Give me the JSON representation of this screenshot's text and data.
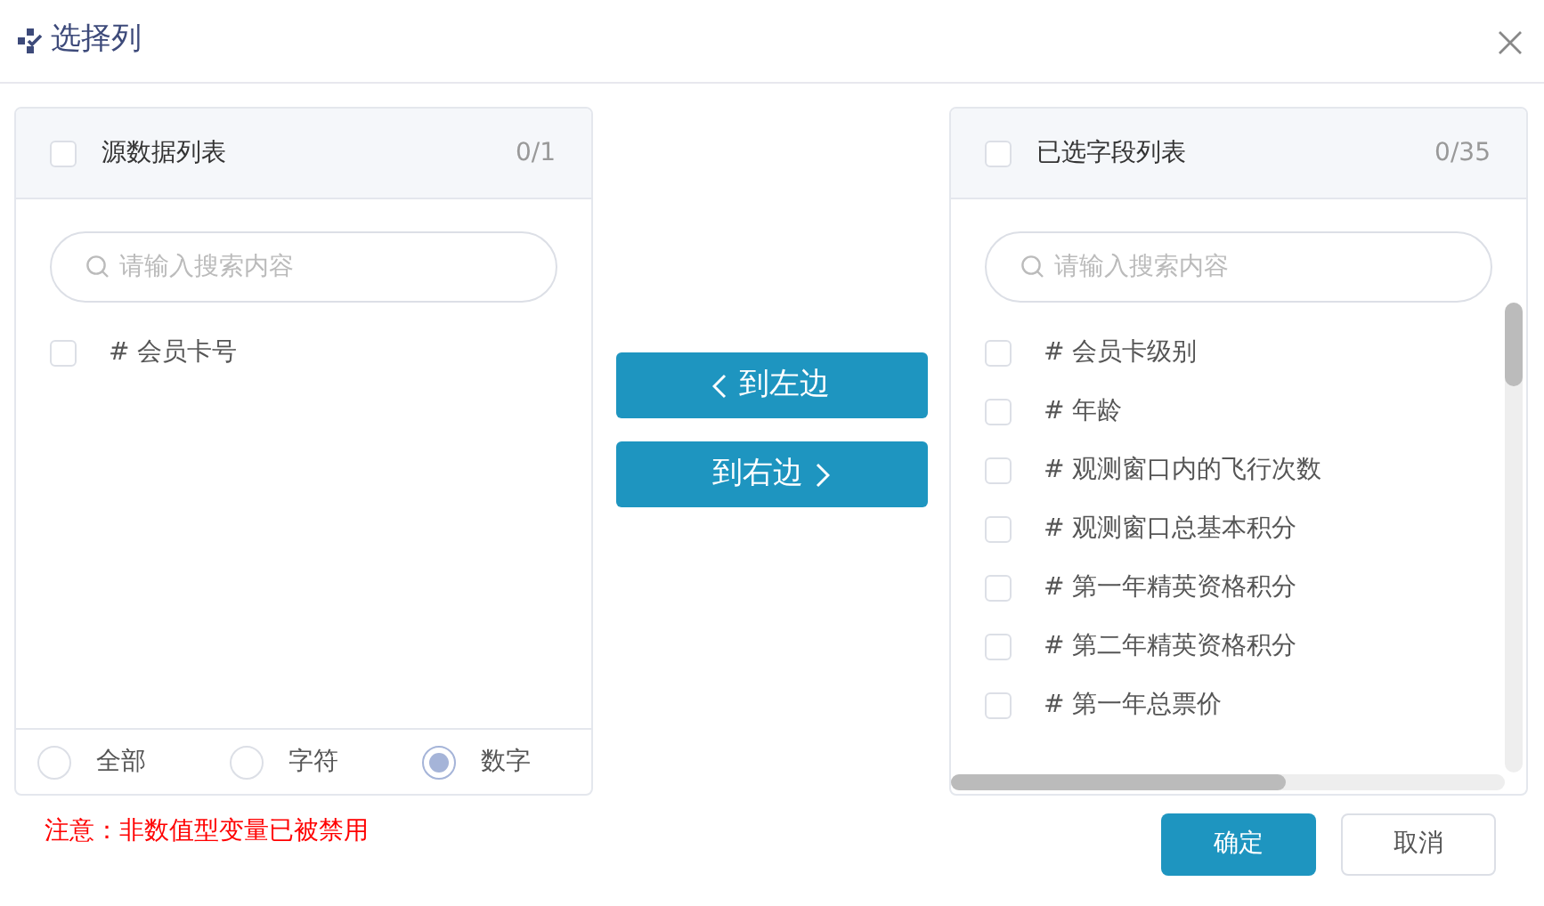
{
  "window": {
    "title": "选择列"
  },
  "source_panel": {
    "title": "源数据列表",
    "checked": false,
    "count": "0/1",
    "search": {
      "placeholder": "请输入搜索内容"
    },
    "items": [
      {
        "label": "# 会员卡号",
        "checked": false
      }
    ],
    "filters": [
      {
        "label": "全部",
        "selected": false
      },
      {
        "label": "字符",
        "selected": false
      },
      {
        "label": "数字",
        "selected": true
      }
    ]
  },
  "transfer_buttons": [
    {
      "kind": "to-left",
      "label": "到左边"
    },
    {
      "kind": "to-right",
      "label": "到右边"
    }
  ],
  "target_panel": {
    "title": "已选字段列表",
    "checked": false,
    "count": "0/35",
    "search": {
      "placeholder": "请输入搜索内容"
    },
    "items": [
      {
        "label": "# 会员卡级别",
        "checked": false
      },
      {
        "label": "# 年龄",
        "checked": false
      },
      {
        "label": "# 观测窗口内的飞行次数",
        "checked": false
      },
      {
        "label": "# 观测窗口总基本积分",
        "checked": false
      },
      {
        "label": "# 第一年精英资格积分",
        "checked": false
      },
      {
        "label": "# 第二年精英资格积分",
        "checked": false
      },
      {
        "label": "# 第一年总票价",
        "checked": false
      }
    ]
  },
  "warning": "注意：非数值型变量已被禁用",
  "buttons": [
    {
      "kind": "primary",
      "label": "确定"
    },
    {
      "kind": "secondary",
      "label": "取消"
    }
  ]
}
